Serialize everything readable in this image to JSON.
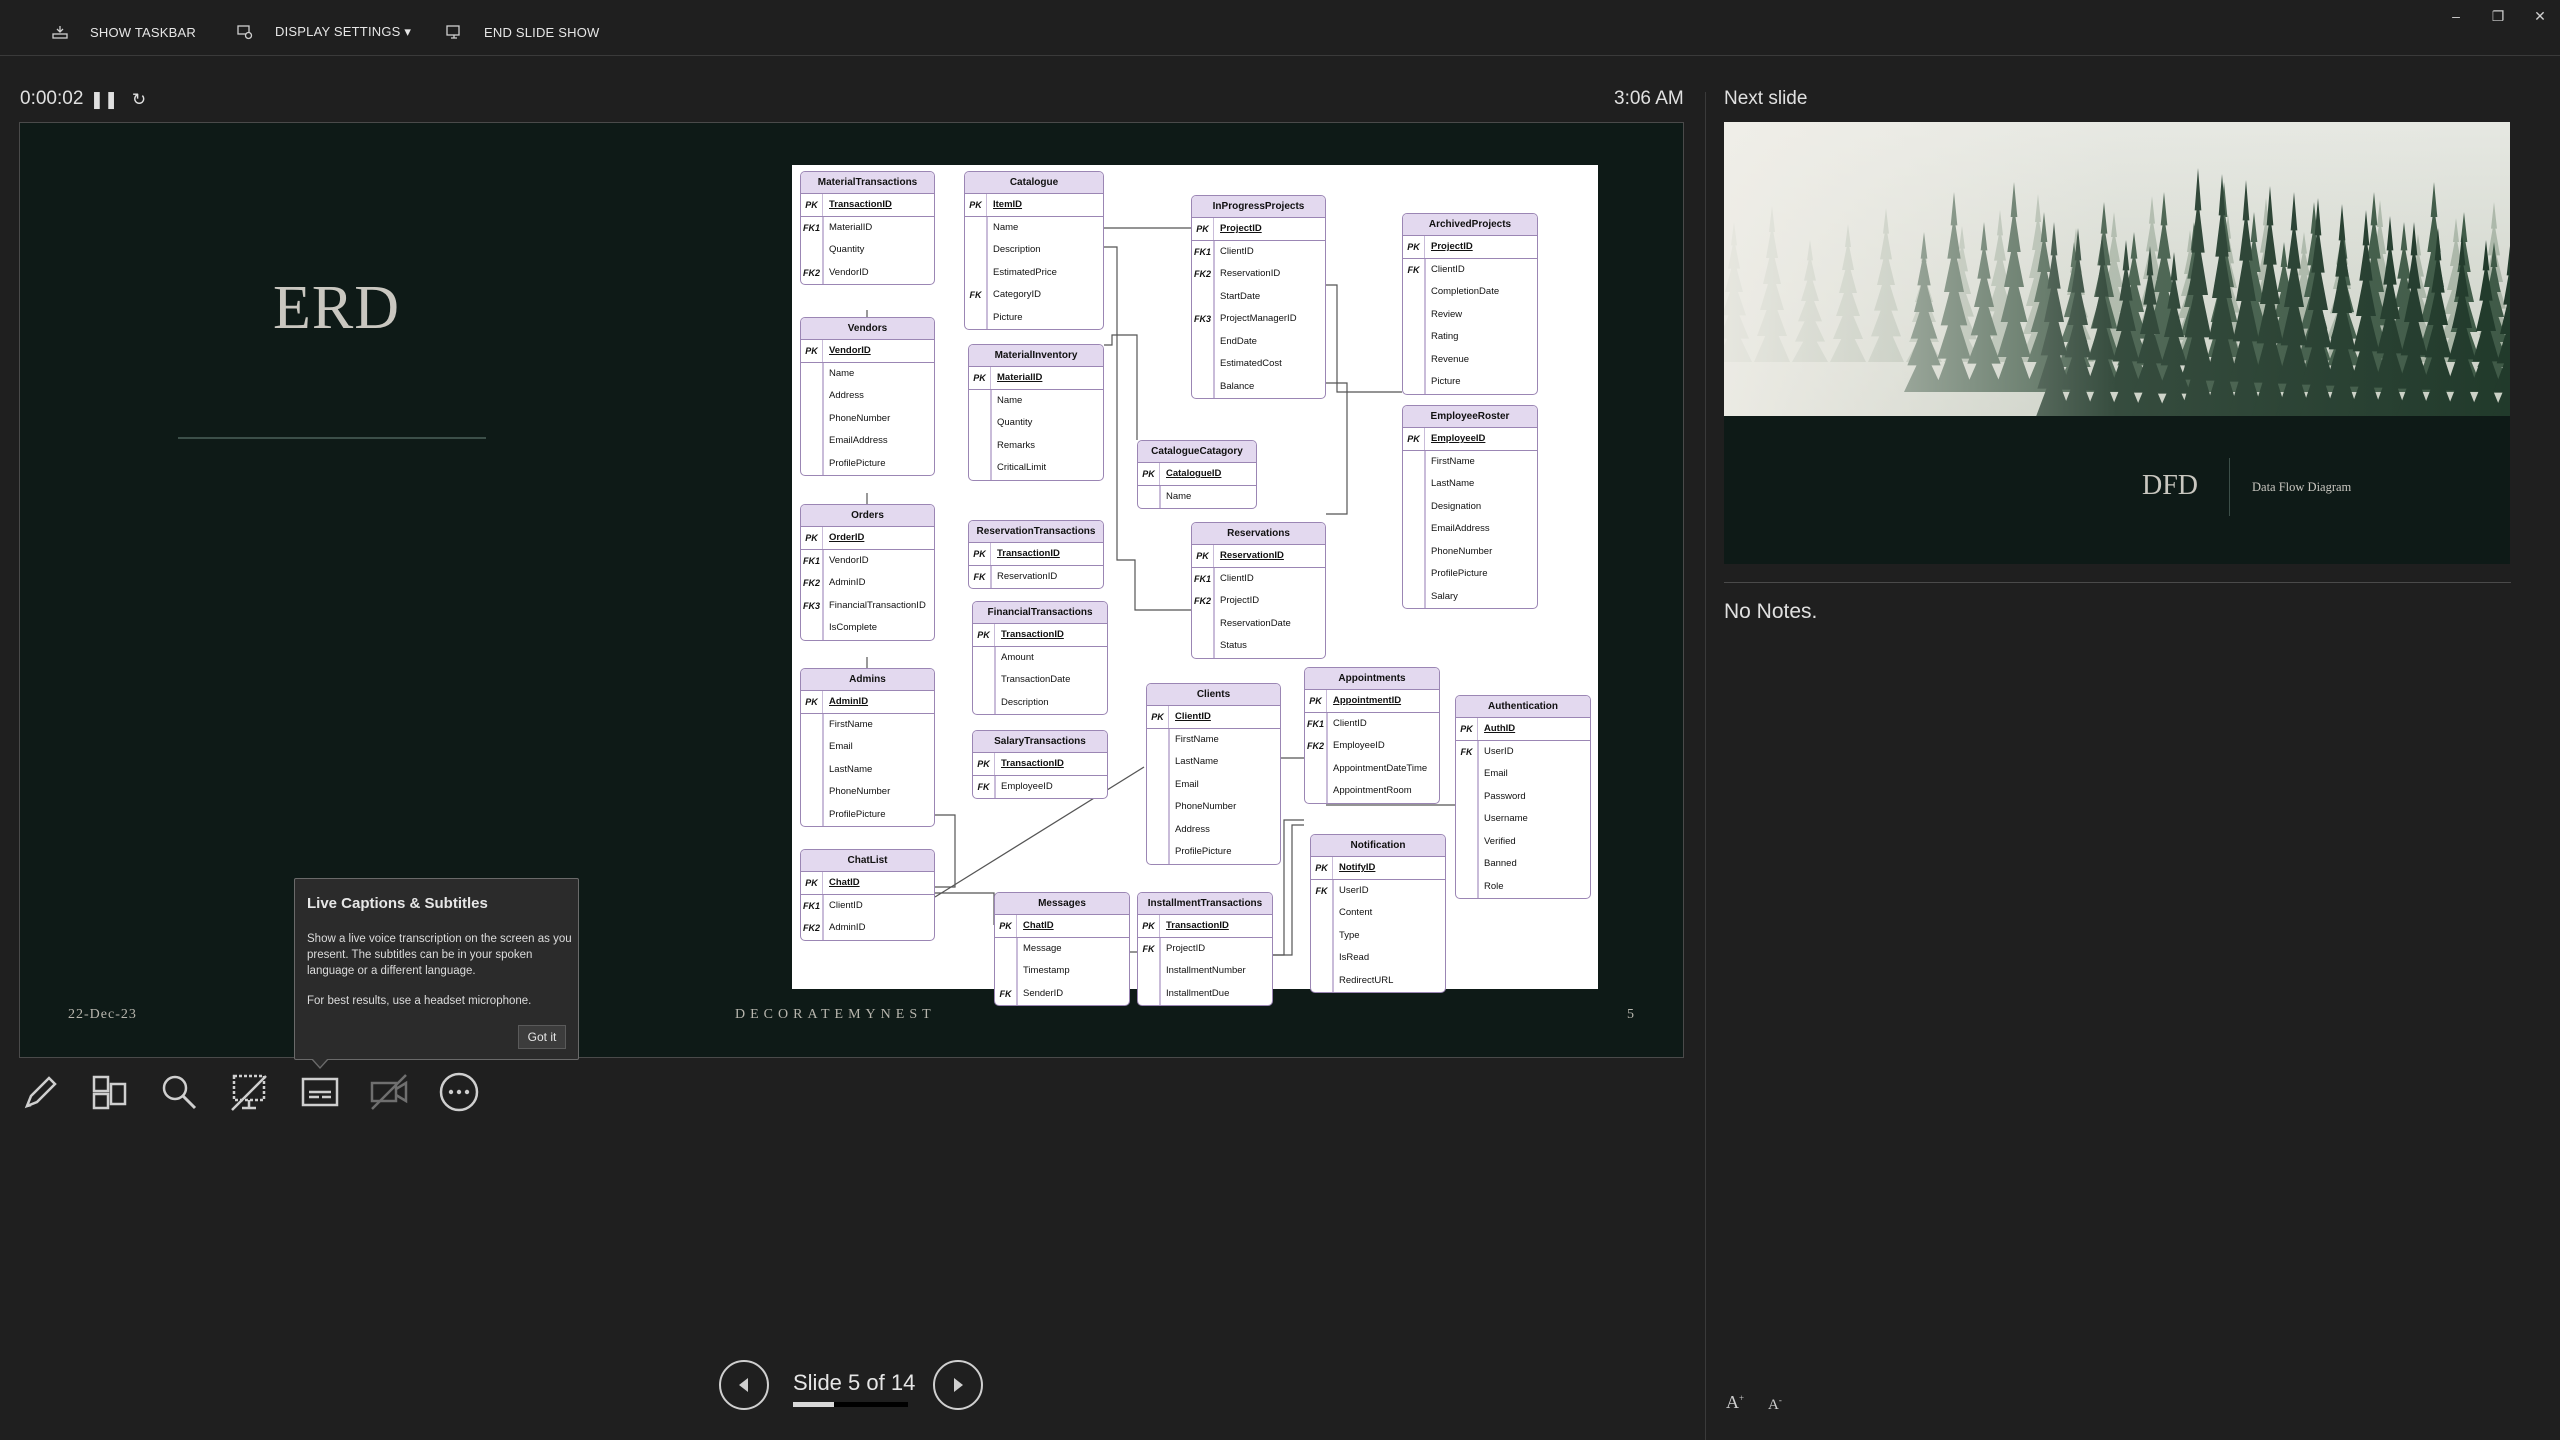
{
  "toolbar": {
    "show_taskbar": "SHOW TASKBAR",
    "display_settings": "DISPLAY SETTINGS ▾",
    "end_slide_show": "END SLIDE SHOW"
  },
  "timer": {
    "elapsed": "0:00:02",
    "clock": "3:06 AM"
  },
  "slide": {
    "title": "ERD",
    "date": "22-Dec-23",
    "footer": "DECORATEMYNEST",
    "number": "5"
  },
  "erd": {
    "tables": [
      {
        "name": "MaterialTransactions",
        "keys": [
          [
            "PK",
            "TransactionID"
          ]
        ],
        "rows": [
          [
            "FK1",
            "MaterialID"
          ],
          [
            "",
            "Quantity"
          ],
          [
            "FK2",
            "VendorID"
          ]
        ]
      },
      {
        "name": "Vendors",
        "keys": [
          [
            "PK",
            "VendorID"
          ]
        ],
        "rows": [
          [
            "",
            "Name"
          ],
          [
            "",
            "Address"
          ],
          [
            "",
            "PhoneNumber"
          ],
          [
            "",
            "EmailAddress"
          ],
          [
            "",
            "ProfilePicture"
          ]
        ]
      },
      {
        "name": "Orders",
        "keys": [
          [
            "PK",
            "OrderID"
          ]
        ],
        "rows": [
          [
            "FK1",
            "VendorID"
          ],
          [
            "FK2",
            "AdminID"
          ],
          [
            "FK3",
            "FinancialTransactionID"
          ],
          [
            "",
            "IsComplete"
          ]
        ]
      },
      {
        "name": "Admins",
        "keys": [
          [
            "PK",
            "AdminID"
          ]
        ],
        "rows": [
          [
            "",
            "FirstName"
          ],
          [
            "",
            "Email"
          ],
          [
            "",
            "LastName"
          ],
          [
            "",
            "PhoneNumber"
          ],
          [
            "",
            "ProfilePicture"
          ]
        ]
      },
      {
        "name": "ChatList",
        "keys": [
          [
            "PK",
            "ChatID"
          ]
        ],
        "rows": [
          [
            "FK1",
            "ClientID"
          ],
          [
            "FK2",
            "AdminID"
          ]
        ]
      },
      {
        "name": "Catalogue",
        "keys": [
          [
            "PK",
            "ItemID"
          ]
        ],
        "rows": [
          [
            "",
            "Name"
          ],
          [
            "",
            "Description"
          ],
          [
            "",
            "EstimatedPrice"
          ],
          [
            "FK",
            "CategoryID"
          ],
          [
            "",
            "Picture"
          ]
        ]
      },
      {
        "name": "MaterialInventory",
        "keys": [
          [
            "PK",
            "MaterialID"
          ]
        ],
        "rows": [
          [
            "",
            "Name"
          ],
          [
            "",
            "Quantity"
          ],
          [
            "",
            "Remarks"
          ],
          [
            "",
            "CriticalLimit"
          ]
        ]
      },
      {
        "name": "ReservationTransactions",
        "keys": [
          [
            "PK",
            "TransactionID"
          ]
        ],
        "rows": [
          [
            "FK",
            "ReservationID"
          ]
        ]
      },
      {
        "name": "FinancialTransactions",
        "keys": [
          [
            "PK",
            "TransactionID"
          ]
        ],
        "rows": [
          [
            "",
            "Amount"
          ],
          [
            "",
            "TransactionDate"
          ],
          [
            "",
            "Description"
          ]
        ]
      },
      {
        "name": "SalaryTransactions",
        "keys": [
          [
            "PK",
            "TransactionID"
          ]
        ],
        "rows": [
          [
            "FK",
            "EmployeeID"
          ]
        ]
      },
      {
        "name": "Messages",
        "keys": [
          [
            "PK",
            "ChatID"
          ]
        ],
        "rows": [
          [
            "",
            "Message"
          ],
          [
            "",
            "Timestamp"
          ],
          [
            "FK",
            "SenderID"
          ]
        ]
      },
      {
        "name": "InProgressProjects",
        "keys": [
          [
            "PK",
            "ProjectID"
          ]
        ],
        "rows": [
          [
            "FK1",
            "ClientID"
          ],
          [
            "FK2",
            "ReservationID"
          ],
          [
            "",
            "StartDate"
          ],
          [
            "FK3",
            "ProjectManagerID"
          ],
          [
            "",
            "EndDate"
          ],
          [
            "",
            "EstimatedCost"
          ],
          [
            "",
            "Balance"
          ]
        ]
      },
      {
        "name": "CatalogueCatagory",
        "keys": [
          [
            "PK",
            "CatalogueID"
          ]
        ],
        "rows": [
          [
            "",
            "Name"
          ]
        ]
      },
      {
        "name": "Reservations",
        "keys": [
          [
            "PK",
            "ReservationID"
          ]
        ],
        "rows": [
          [
            "FK1",
            "ClientID"
          ],
          [
            "FK2",
            "ProjectID"
          ],
          [
            "",
            "ReservationDate"
          ],
          [
            "",
            "Status"
          ]
        ]
      },
      {
        "name": "Clients",
        "keys": [
          [
            "PK",
            "ClientID"
          ]
        ],
        "rows": [
          [
            "",
            "FirstName"
          ],
          [
            "",
            "LastName"
          ],
          [
            "",
            "Email"
          ],
          [
            "",
            "PhoneNumber"
          ],
          [
            "",
            "Address"
          ],
          [
            "",
            "ProfilePicture"
          ]
        ]
      },
      {
        "name": "InstallmentTransactions",
        "keys": [
          [
            "PK",
            "TransactionID"
          ]
        ],
        "rows": [
          [
            "FK",
            "ProjectID"
          ],
          [
            "",
            "InstallmentNumber"
          ],
          [
            "",
            "InstallmentDue"
          ]
        ]
      },
      {
        "name": "ArchivedProjects",
        "keys": [
          [
            "PK",
            "ProjectID"
          ]
        ],
        "rows": [
          [
            "FK",
            "ClientID"
          ],
          [
            "",
            "CompletionDate"
          ],
          [
            "",
            "Review"
          ],
          [
            "",
            "Rating"
          ],
          [
            "",
            "Revenue"
          ],
          [
            "",
            "Picture"
          ]
        ]
      },
      {
        "name": "EmployeeRoster",
        "keys": [
          [
            "PK",
            "EmployeeID"
          ]
        ],
        "rows": [
          [
            "",
            "FirstName"
          ],
          [
            "",
            "LastName"
          ],
          [
            "",
            "Designation"
          ],
          [
            "",
            "EmailAddress"
          ],
          [
            "",
            "PhoneNumber"
          ],
          [
            "",
            "ProfilePicture"
          ],
          [
            "",
            "Salary"
          ]
        ]
      },
      {
        "name": "Appointments",
        "keys": [
          [
            "PK",
            "AppointmentID"
          ]
        ],
        "rows": [
          [
            "FK1",
            "ClientID"
          ],
          [
            "FK2",
            "EmployeeID"
          ],
          [
            "",
            "AppointmentDateTime"
          ],
          [
            "",
            "AppointmentRoom"
          ]
        ]
      },
      {
        "name": "Authentication",
        "keys": [
          [
            "PK",
            "AuthID"
          ]
        ],
        "rows": [
          [
            "FK",
            "UserID"
          ],
          [
            "",
            "Email"
          ],
          [
            "",
            "Password"
          ],
          [
            "",
            "Username"
          ],
          [
            "",
            "Verified"
          ],
          [
            "",
            "Banned"
          ],
          [
            "",
            "Role"
          ]
        ]
      },
      {
        "name": "Notification",
        "keys": [
          [
            "PK",
            "NotifyID"
          ]
        ],
        "rows": [
          [
            "FK",
            "UserID"
          ],
          [
            "",
            "Content"
          ],
          [
            "",
            "Type"
          ],
          [
            "",
            "IsRead"
          ],
          [
            "",
            "RedirectURL"
          ]
        ]
      }
    ]
  },
  "tooltip": {
    "title": "Live Captions & Subtitles",
    "body": "Show a live voice transcription on the screen as you present. The subtitles can be in your spoken language or a different language.",
    "hint": "For best results, use a headset microphone.",
    "button": "Got it"
  },
  "navigation": {
    "slide_counter": "Slide 5 of 14",
    "progress": 0.357
  },
  "next_slide": {
    "label": "Next slide",
    "title": "DFD",
    "subtitle": "Data Flow Diagram"
  },
  "notes": {
    "text": "No Notes."
  },
  "icons": {
    "show_taskbar": "taskbar-icon",
    "display_settings": "display-settings-icon",
    "end_show": "end-show-icon",
    "pause": "pause-icon",
    "restart": "restart-icon",
    "pen": "pen-icon",
    "slides": "all-slides-icon",
    "zoom": "magnifier-icon",
    "black_screen": "black-screen-icon",
    "subtitles": "subtitles-icon",
    "camera": "camera-off-icon",
    "more": "more-options-icon"
  }
}
